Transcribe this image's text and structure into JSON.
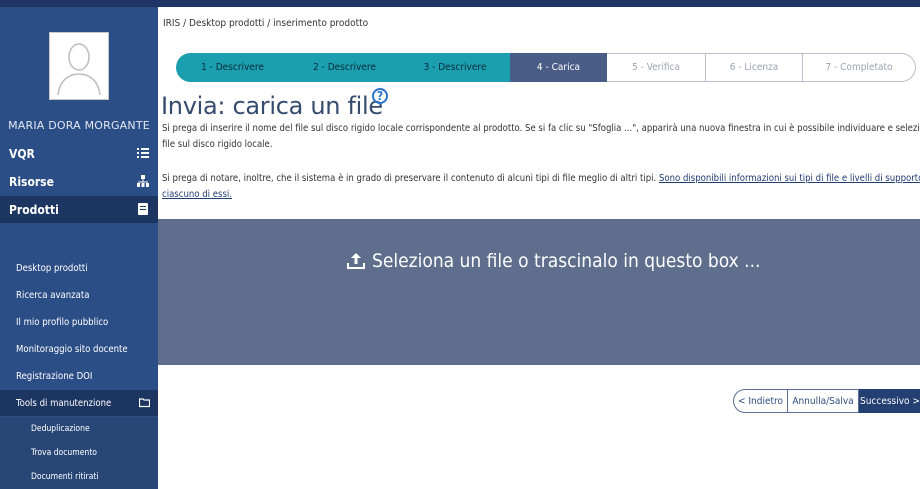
{
  "sidebar": {
    "user_name": "MARIA DORA MORGANTE",
    "sections": [
      {
        "label": "VQR",
        "icon": "list-icon"
      },
      {
        "label": "Risorse",
        "icon": "sitemap-icon"
      },
      {
        "label": "Prodotti",
        "icon": "book-icon"
      }
    ],
    "products_items": [
      {
        "label": "Desktop prodotti"
      },
      {
        "label": "Ricerca avanzata"
      },
      {
        "label": "Il mio profilo pubblico"
      },
      {
        "label": "Monitoraggio sito docente"
      },
      {
        "label": "Registrazione DOI"
      },
      {
        "label": "Tools di manutenzione",
        "icon": "folder-icon"
      }
    ],
    "tools_items": [
      {
        "label": "Deduplicazione"
      },
      {
        "label": "Trova documento"
      },
      {
        "label": "Documenti ritirati"
      }
    ]
  },
  "breadcrumb": "IRIS / Desktop prodotti / inserimento prodotto",
  "steps": [
    {
      "label": "1 - Descrivere",
      "state": "done"
    },
    {
      "label": "2 - Descrivere",
      "state": "done"
    },
    {
      "label": "3 - Descrivere",
      "state": "done"
    },
    {
      "label": "4 - Carica",
      "state": "current"
    },
    {
      "label": "5 - Verifica",
      "state": "todo"
    },
    {
      "label": "6 - Licenza",
      "state": "todo"
    },
    {
      "label": "7 - Completato",
      "state": "todo"
    }
  ],
  "page_title": "Invia: carica un file",
  "help_symbol": "?",
  "instructions": {
    "line1": "Si prega di inserire il nome del file sul disco rigido locale corrispondente al prodotto. Se si fa clic su \"Sfoglia ...\", apparirà una nuova finestra in cui è possibile individuare e selezionare il",
    "line2": "file sul disco rigido locale.",
    "note_text": "Si prega di notare, inoltre, che il sistema è in grado di preservare il contenuto di alcuni tipi di file meglio di altri tipi. ",
    "note_link_line1": "Sono disponibili informazioni sui tipi di file e livelli di supporto per",
    "note_link_line2": "ciascuno di essi."
  },
  "dropzone_label": "Seleziona un file o trascinalo in questo box ...",
  "buttons": {
    "back": "< Indietro",
    "cancel_save": "Annulla/Salva",
    "next": "Successivo >"
  },
  "colors": {
    "sidebar": "#2c4e86",
    "sidebar_active": "#1c3561",
    "step_done": "#1b9fae",
    "step_current": "#4a5d86",
    "dropzone": "#5e6e8c",
    "next_button": "#243f72"
  }
}
